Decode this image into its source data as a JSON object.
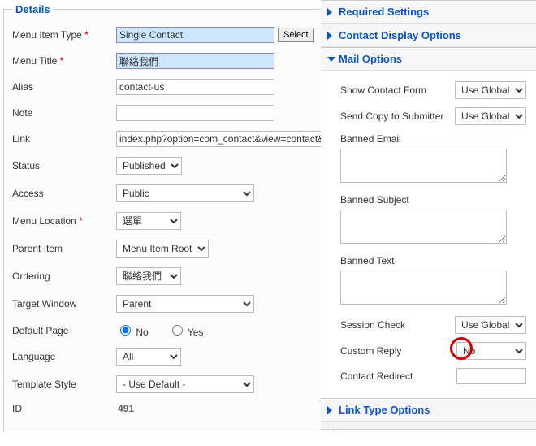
{
  "details": {
    "legend": "Details",
    "menu_item_type": {
      "label": "Menu Item Type",
      "value": "Single Contact",
      "button": "Select"
    },
    "menu_title": {
      "label": "Menu Title",
      "value": "聯絡我們"
    },
    "alias": {
      "label": "Alias",
      "value": "contact-us"
    },
    "note": {
      "label": "Note",
      "value": ""
    },
    "link": {
      "label": "Link",
      "value": "index.php?option=com_contact&view=contact&"
    },
    "status": {
      "label": "Status",
      "value": "Published"
    },
    "access": {
      "label": "Access",
      "value": "Public"
    },
    "menu_location": {
      "label": "Menu Location",
      "value": "選單"
    },
    "parent_item": {
      "label": "Parent Item",
      "value": "Menu Item Root"
    },
    "ordering": {
      "label": "Ordering",
      "value": "聯絡我們"
    },
    "target_window": {
      "label": "Target Window",
      "value": "Parent"
    },
    "default_page": {
      "label": "Default Page",
      "no": "No",
      "yes": "Yes"
    },
    "language": {
      "label": "Language",
      "value": "All"
    },
    "template_style": {
      "label": "Template Style",
      "value": "- Use Default -"
    },
    "id": {
      "label": "ID",
      "value": "491"
    }
  },
  "panels": {
    "required": "Required Settings",
    "contact_display": "Contact Display Options",
    "mail_options": "Mail Options",
    "link_type": "Link Type Options"
  },
  "mail": {
    "show_contact_form": {
      "label": "Show Contact Form",
      "value": "Use Global"
    },
    "send_copy": {
      "label": "Send Copy to Submitter",
      "value": "Use Global"
    },
    "banned_email": {
      "label": "Banned Email",
      "value": ""
    },
    "banned_subject": {
      "label": "Banned Subject",
      "value": ""
    },
    "banned_text": {
      "label": "Banned Text",
      "value": ""
    },
    "session_check": {
      "label": "Session Check",
      "value": "Use Global"
    },
    "custom_reply": {
      "label": "Custom Reply",
      "value": "No"
    },
    "contact_redirect": {
      "label": "Contact Redirect",
      "value": ""
    }
  }
}
